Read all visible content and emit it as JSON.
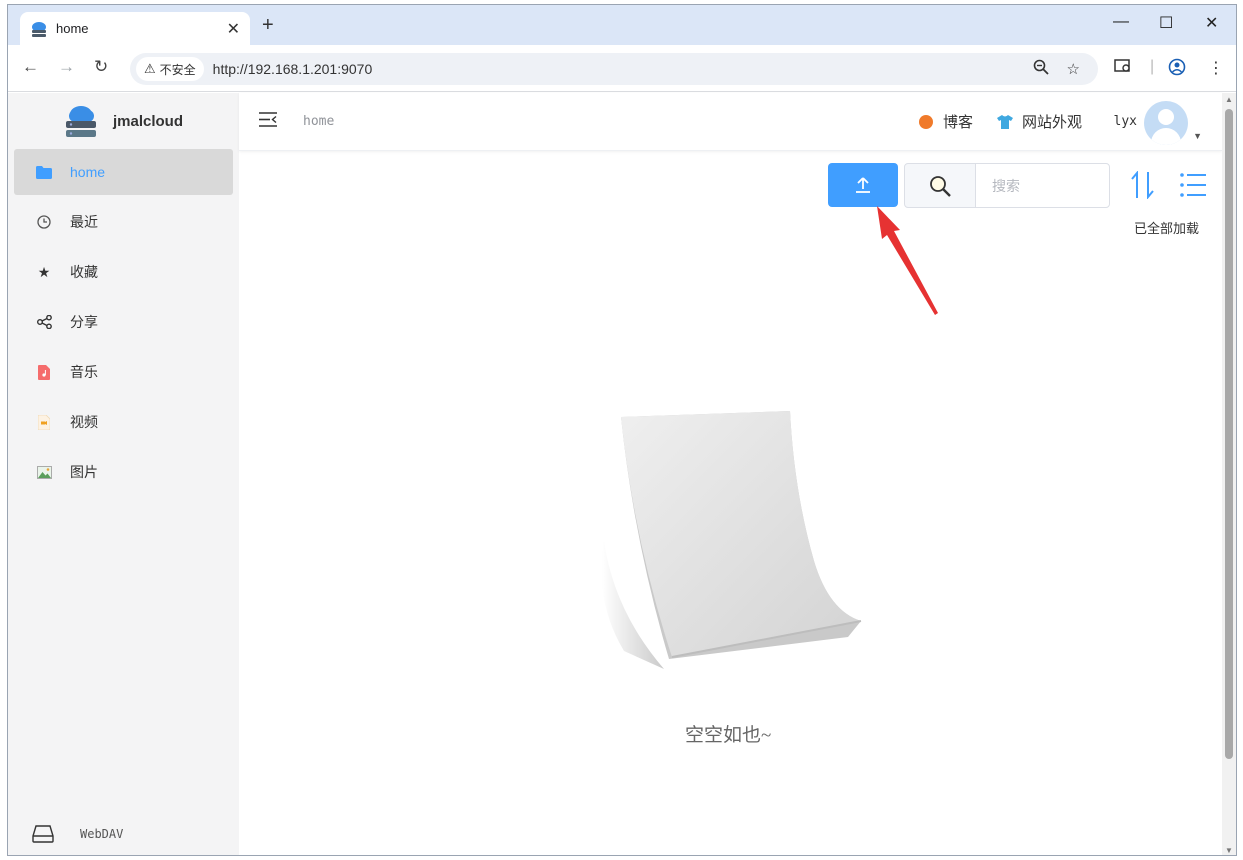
{
  "browser": {
    "tab_title": "home",
    "tab_close": "✕",
    "new_tab": "+",
    "security_label": "不安全",
    "url": "http://192.168.1.201:9070",
    "window_controls": {
      "minimize": "—",
      "maximize": "☐",
      "close": "✕"
    }
  },
  "app": {
    "brand_name": "jmalcloud",
    "sidebar": {
      "items": [
        {
          "label": "home",
          "icon": "folder-icon",
          "active": true
        },
        {
          "label": "最近",
          "icon": "clock-icon",
          "active": false
        },
        {
          "label": "收藏",
          "icon": "star-icon",
          "active": false
        },
        {
          "label": "分享",
          "icon": "share-icon",
          "active": false
        },
        {
          "label": "音乐",
          "icon": "music-file-icon",
          "active": false
        },
        {
          "label": "视频",
          "icon": "video-file-icon",
          "active": false
        },
        {
          "label": "图片",
          "icon": "image-file-icon",
          "active": false
        }
      ],
      "webdav_label": "WebDAV"
    },
    "header": {
      "breadcrumb": "home",
      "blog_link": "博客",
      "appearance_link": "网站外观",
      "username": "lyx"
    },
    "toolbar": {
      "search_placeholder": "搜索",
      "loaded_status": "已全部加载"
    },
    "empty_state": {
      "text": "空空如也~"
    },
    "colors": {
      "accent": "#409eff",
      "annotation_arrow": "#e63232"
    }
  }
}
